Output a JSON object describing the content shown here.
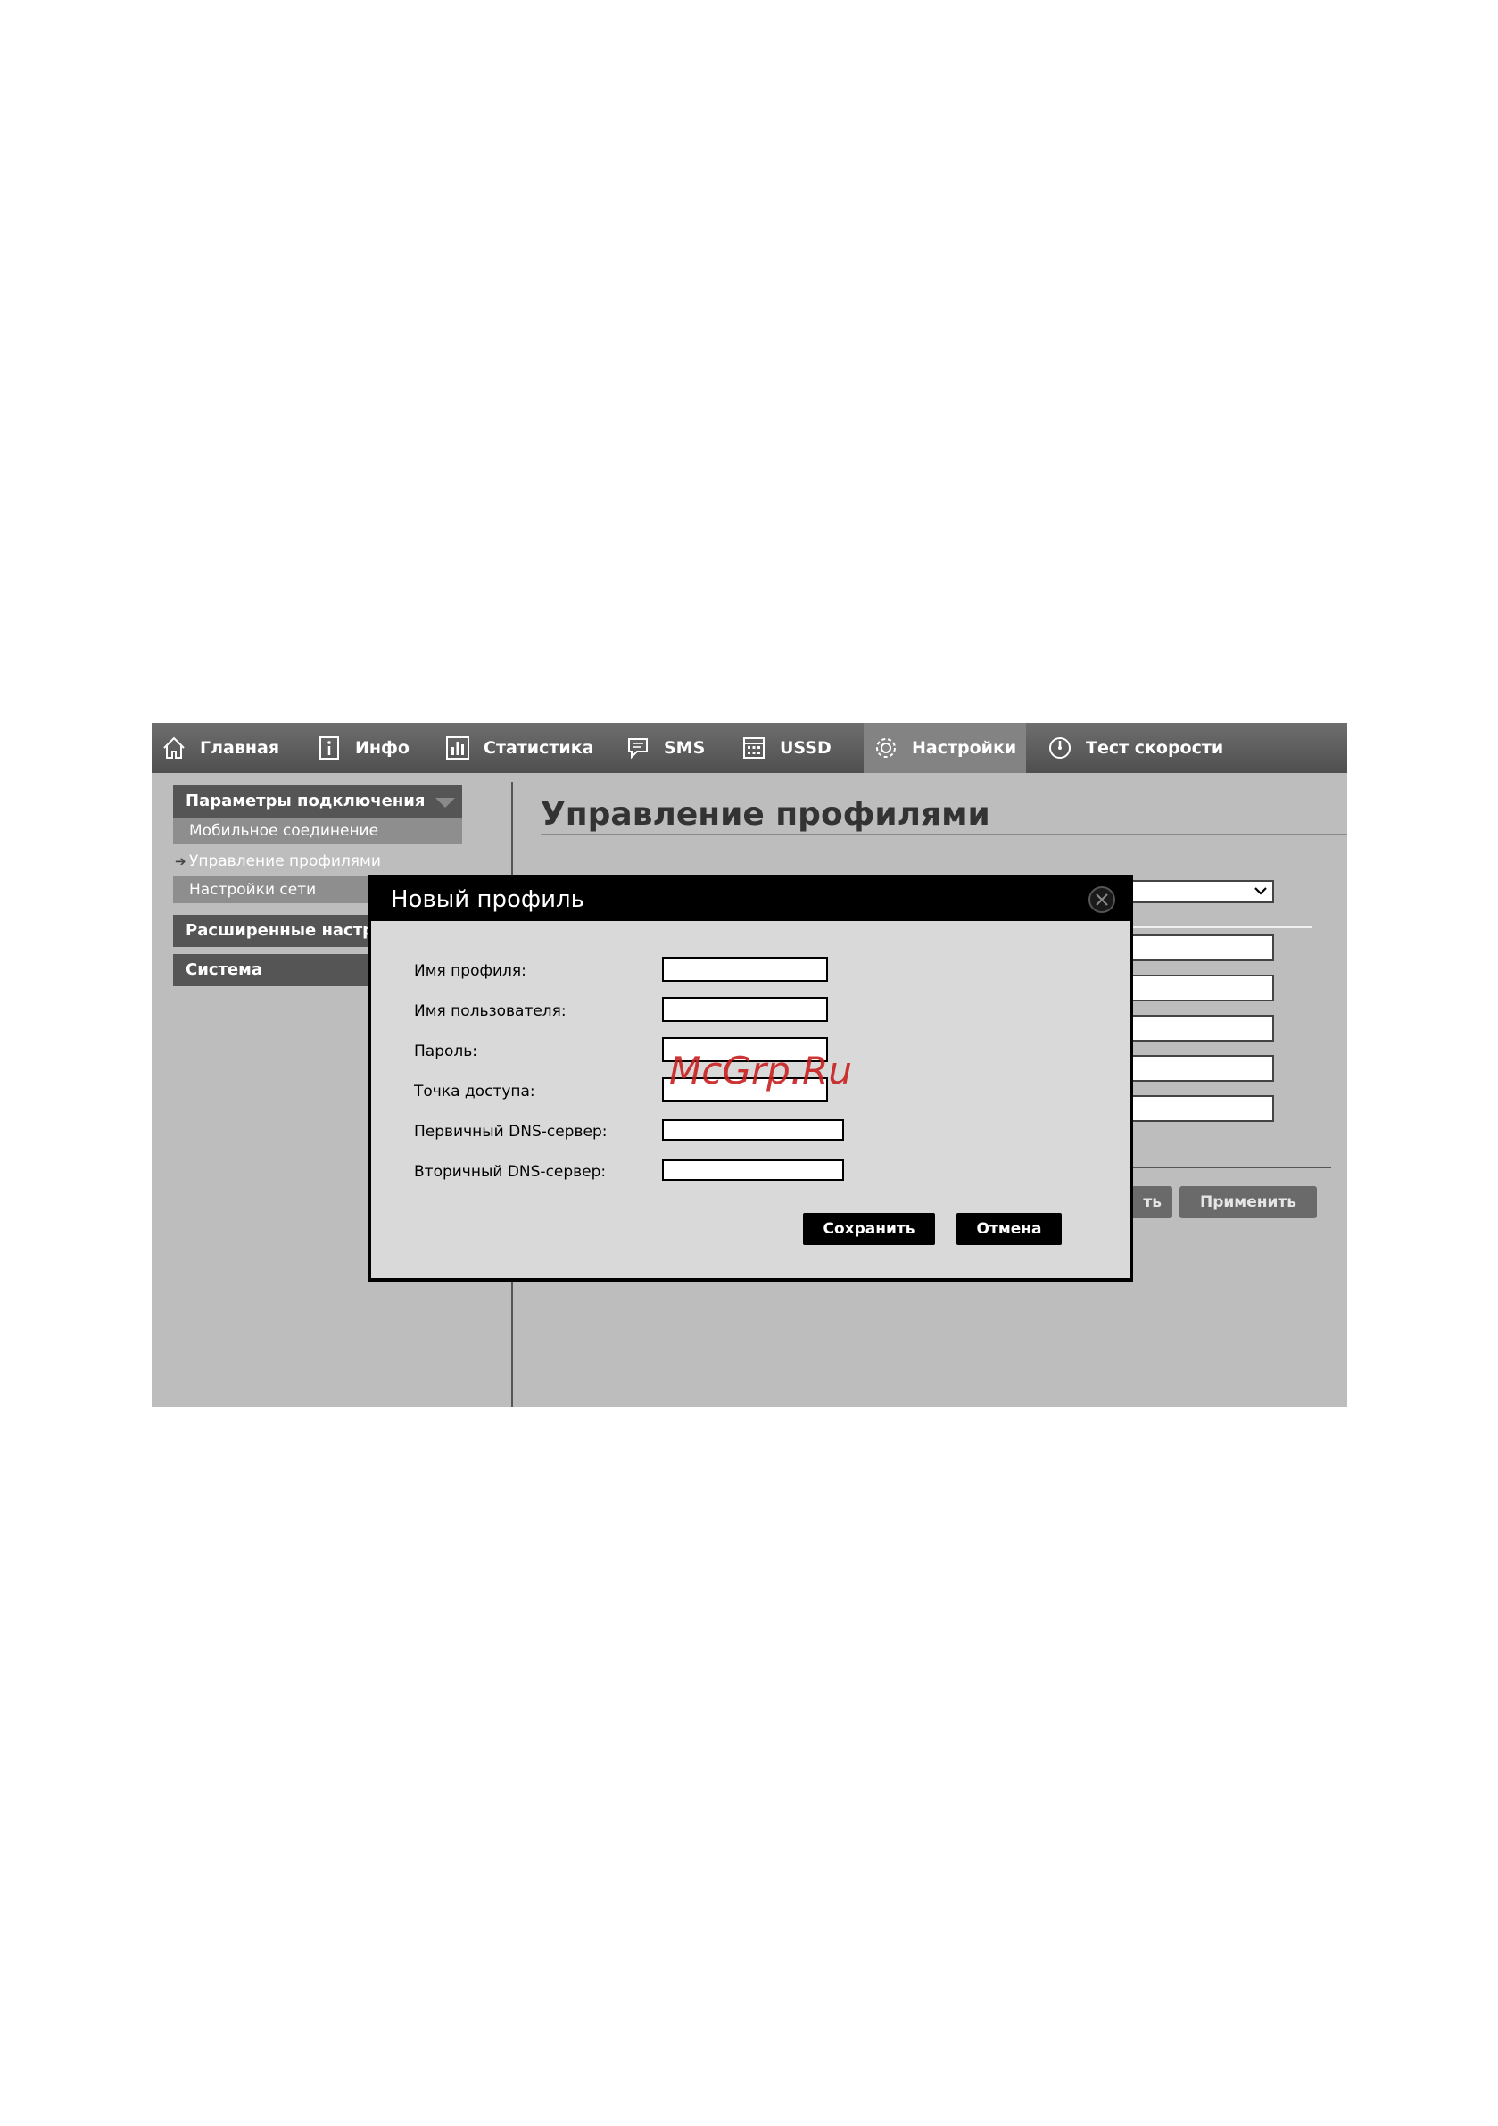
{
  "nav": {
    "items": [
      {
        "label": "Главная",
        "icon": "home-icon"
      },
      {
        "label": "Инфо",
        "icon": "info-icon"
      },
      {
        "label": "Статистика",
        "icon": "statistics-icon"
      },
      {
        "label": "SMS",
        "icon": "sms-icon"
      },
      {
        "label": "USSD",
        "icon": "ussd-icon"
      },
      {
        "label": "Настройки",
        "icon": "gear-icon",
        "active": true
      },
      {
        "label": "Тест скорости",
        "icon": "speedtest-icon"
      }
    ]
  },
  "sidebar": {
    "section1": "Параметры подключения",
    "items": [
      "Мобильное соединение",
      "Управление профилями",
      "Настройки сети"
    ],
    "section2": "Расширенные настр",
    "section3": "Система"
  },
  "main": {
    "title": "Управление профилями",
    "buttons": [
      "ть",
      "Применить"
    ]
  },
  "modal": {
    "title": "Новый профиль",
    "fields": [
      {
        "label": "Имя профиля:",
        "value": ""
      },
      {
        "label": "Имя пользователя:",
        "value": ""
      },
      {
        "label": "Пароль:",
        "value": ""
      },
      {
        "label": "Точка доступа:",
        "value": ""
      },
      {
        "label": "Первичный DNS-сервер:",
        "value": ""
      },
      {
        "label": "Вторичный DNS-сервер:",
        "value": ""
      }
    ],
    "save_label": "Сохранить",
    "cancel_label": "Отмена"
  },
  "watermark": "McGrp.Ru",
  "colors": {
    "topbar": "#555555",
    "background": "#bdbdbd",
    "modal_background": "#d9d9d9",
    "watermark": "#c81e1e"
  }
}
